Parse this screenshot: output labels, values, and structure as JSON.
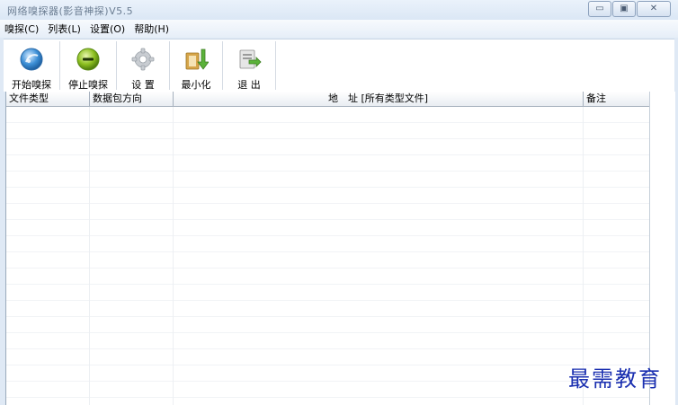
{
  "window": {
    "title": "网络嗅探器(影音神探)V5.5",
    "controls": {
      "minimize": "▭",
      "restore": "▣",
      "close": "✕"
    }
  },
  "menu": {
    "items": [
      "嗅探(C)",
      "列表(L)",
      "设置(O)",
      "帮助(H)"
    ]
  },
  "toolbar": {
    "start_label": "开始嗅探",
    "stop_label": "停止嗅探",
    "settings_label": "设 置",
    "minimize_label": "最小化",
    "exit_label": "退 出"
  },
  "grid": {
    "columns": [
      "文件类型",
      "数据包方向",
      "地　址 [所有类型文件]",
      "备注"
    ]
  },
  "watermark": "最需教育",
  "colors": {
    "start_icon": "#3c8fd6",
    "stop_icon": "#8cbf1f",
    "watermark": "#1a2fb0"
  }
}
